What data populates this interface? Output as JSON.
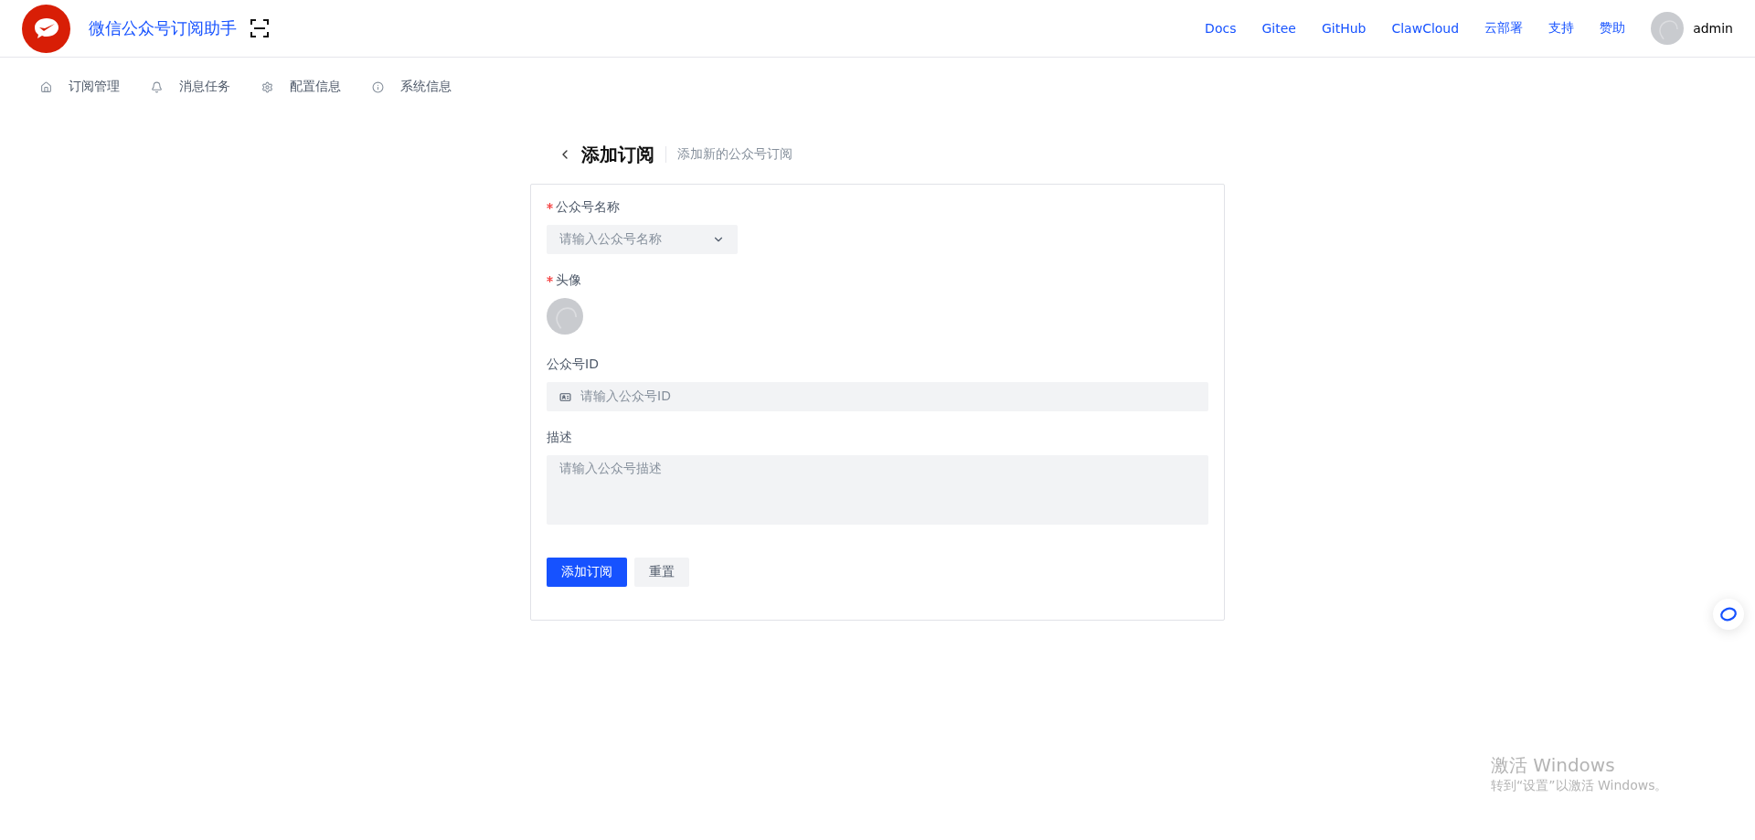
{
  "header": {
    "title": "微信公众号订阅助手",
    "links": [
      "Docs",
      "Gitee",
      "GitHub",
      "ClawCloud",
      "云部署",
      "支持",
      "赞助"
    ],
    "user": "admin"
  },
  "nav": [
    {
      "kind": "home",
      "label": "订阅管理"
    },
    {
      "kind": "bell",
      "label": "消息任务"
    },
    {
      "kind": "gear",
      "label": "配置信息"
    },
    {
      "kind": "info",
      "label": "系统信息"
    }
  ],
  "page": {
    "title": "添加订阅",
    "subtitle": "添加新的公众号订阅"
  },
  "form": {
    "fields": [
      {
        "kind": "select",
        "label": "公众号名称",
        "required": true,
        "placeholder": "请输入公众号名称"
      },
      {
        "kind": "avatar",
        "label": "头像",
        "required": true
      },
      {
        "kind": "input",
        "label": "公众号ID",
        "required": false,
        "placeholder": "请输入公众号ID"
      },
      {
        "kind": "textarea",
        "label": "描述",
        "required": false,
        "placeholder": "请输入公众号描述"
      }
    ],
    "buttons": [
      {
        "label": "添加订阅",
        "primary": true
      },
      {
        "label": "重置",
        "primary": false
      }
    ]
  },
  "watermark": {
    "title": "激活 Windows",
    "text": "转到“设置”以激活 Windows。"
  }
}
